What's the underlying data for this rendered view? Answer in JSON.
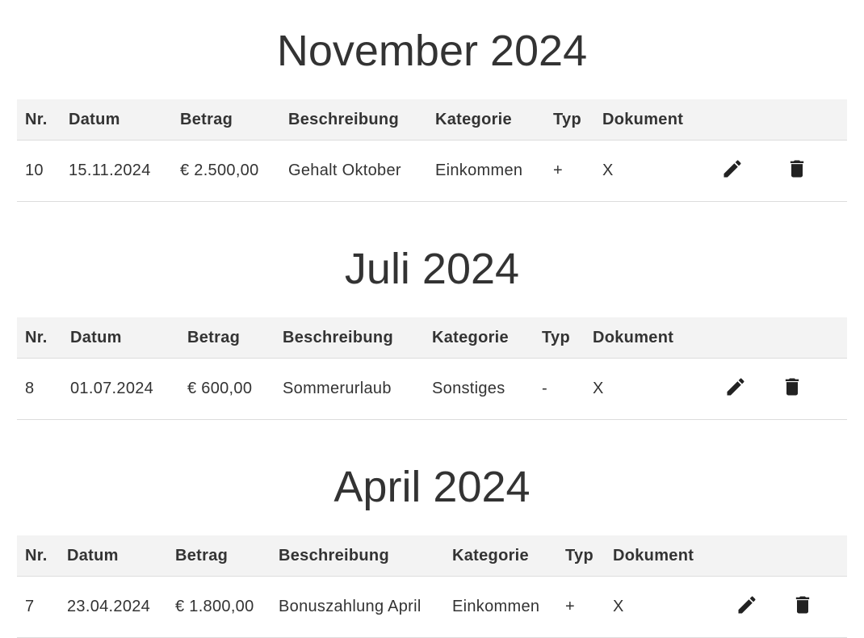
{
  "columns": [
    "Nr.",
    "Datum",
    "Betrag",
    "Beschreibung",
    "Kategorie",
    "Typ",
    "Dokument"
  ],
  "icons": {
    "edit": "pencil-icon",
    "delete": "trash-icon"
  },
  "groups": [
    {
      "title": "November 2024",
      "rows": [
        {
          "nr": "10",
          "datum": "15.11.2024",
          "betrag": "€ 2.500,00",
          "beschreibung": "Gehalt Oktober",
          "kategorie": "Einkommen",
          "typ": "+",
          "dokument": "X"
        }
      ]
    },
    {
      "title": "Juli 2024",
      "rows": [
        {
          "nr": "8",
          "datum": "01.07.2024",
          "betrag": "€ 600,00",
          "beschreibung": "Sommerurlaub",
          "kategorie": "Sonstiges",
          "typ": "-",
          "dokument": "X"
        }
      ]
    },
    {
      "title": "April 2024",
      "rows": [
        {
          "nr": "7",
          "datum": "23.04.2024",
          "betrag": "€ 1.800,00",
          "beschreibung": "Bonuszahlung April",
          "kategorie": "Einkommen",
          "typ": "+",
          "dokument": "X"
        }
      ]
    }
  ]
}
